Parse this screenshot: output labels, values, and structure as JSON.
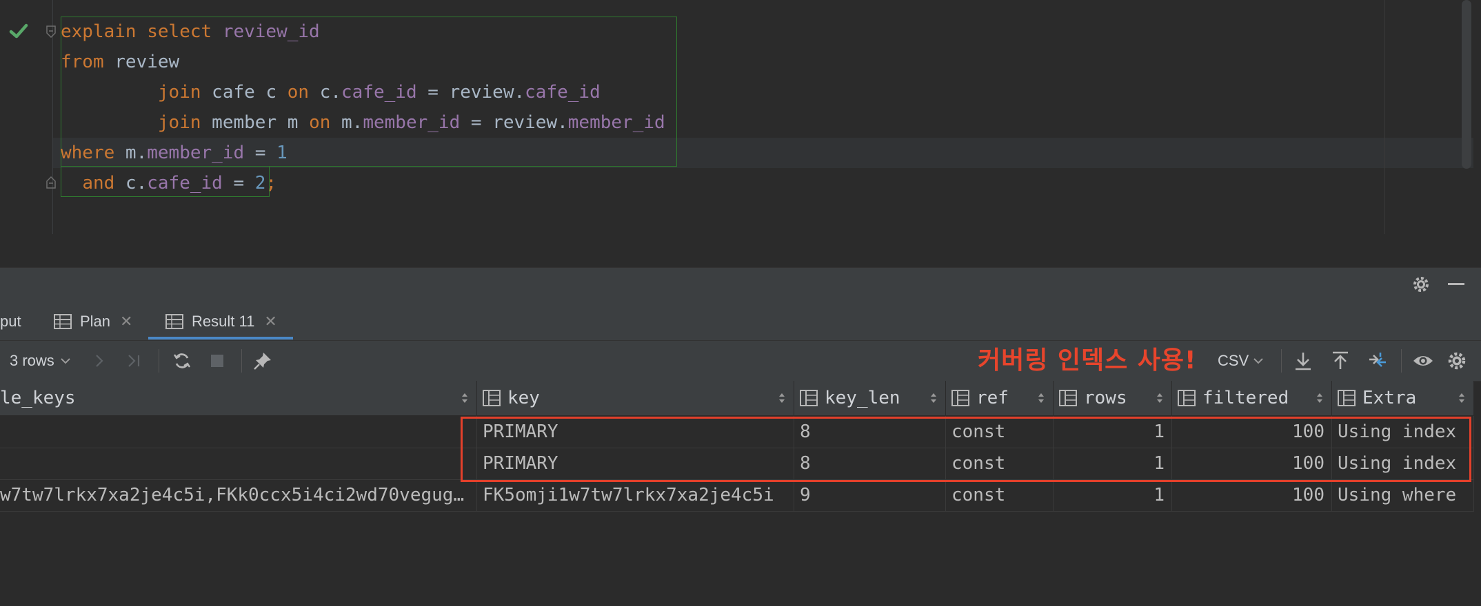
{
  "editor": {
    "code": [
      [
        {
          "t": "explain ",
          "c": "kw"
        },
        {
          "t": "select ",
          "c": "kw"
        },
        {
          "t": "review_id",
          "c": "fld"
        }
      ],
      [
        {
          "t": "from ",
          "c": "kw"
        },
        {
          "t": "review",
          "c": "plain"
        }
      ],
      [
        {
          "t": "         ",
          "c": "plain"
        },
        {
          "t": "join ",
          "c": "kw"
        },
        {
          "t": "cafe c ",
          "c": "plain"
        },
        {
          "t": "on ",
          "c": "kw"
        },
        {
          "t": "c.",
          "c": "plain"
        },
        {
          "t": "cafe_id",
          "c": "fld"
        },
        {
          "t": " = review.",
          "c": "plain"
        },
        {
          "t": "cafe_id",
          "c": "fld"
        }
      ],
      [
        {
          "t": "         ",
          "c": "plain"
        },
        {
          "t": "join ",
          "c": "kw"
        },
        {
          "t": "member m ",
          "c": "plain"
        },
        {
          "t": "on ",
          "c": "kw"
        },
        {
          "t": "m.",
          "c": "plain"
        },
        {
          "t": "member_id",
          "c": "fld"
        },
        {
          "t": " = review.",
          "c": "plain"
        },
        {
          "t": "member_id",
          "c": "fld"
        }
      ],
      [
        {
          "t": "where ",
          "c": "kw"
        },
        {
          "t": "m.",
          "c": "plain"
        },
        {
          "t": "member_id",
          "c": "fld"
        },
        {
          "t": " = ",
          "c": "plain"
        },
        {
          "t": "1",
          "c": "num"
        }
      ],
      [
        {
          "t": "  ",
          "c": "plain"
        },
        {
          "t": "and ",
          "c": "kw"
        },
        {
          "t": "c.",
          "c": "plain"
        },
        {
          "t": "cafe_id",
          "c": "fld"
        },
        {
          "t": " = ",
          "c": "plain"
        },
        {
          "t": "2",
          "c": "num"
        },
        {
          "t": ";",
          "c": "kw"
        }
      ]
    ]
  },
  "tabs": {
    "output_label": "put",
    "plan_label": "Plan",
    "result_label": "Result 11"
  },
  "toolbar": {
    "rows_label": "3 rows",
    "export_format": "CSV"
  },
  "annotation": "커버링 인덱스 사용!",
  "grid": {
    "columns": [
      "le_keys",
      "key",
      "key_len",
      "ref",
      "rows",
      "filtered",
      "Extra"
    ],
    "rows": [
      [
        "",
        "PRIMARY",
        "8",
        "const",
        "1",
        "100",
        "Using index"
      ],
      [
        "",
        "PRIMARY",
        "8",
        "const",
        "1",
        "100",
        "Using index"
      ],
      [
        "w7tw7lrkx7xa2je4c5i,FKk0ccx5i4ci2wd70vegug…",
        "FK5omji1w7tw7lrkx7xa2je4c5i",
        "9",
        "const",
        "1",
        "100",
        "Using where"
      ]
    ]
  },
  "colors": {
    "keyword": "#cc7832",
    "field": "#9876aa",
    "number": "#6897bb",
    "annotation": "#e8452c",
    "highlight_border": "#e3402b",
    "tab_underline": "#4a88c7"
  }
}
